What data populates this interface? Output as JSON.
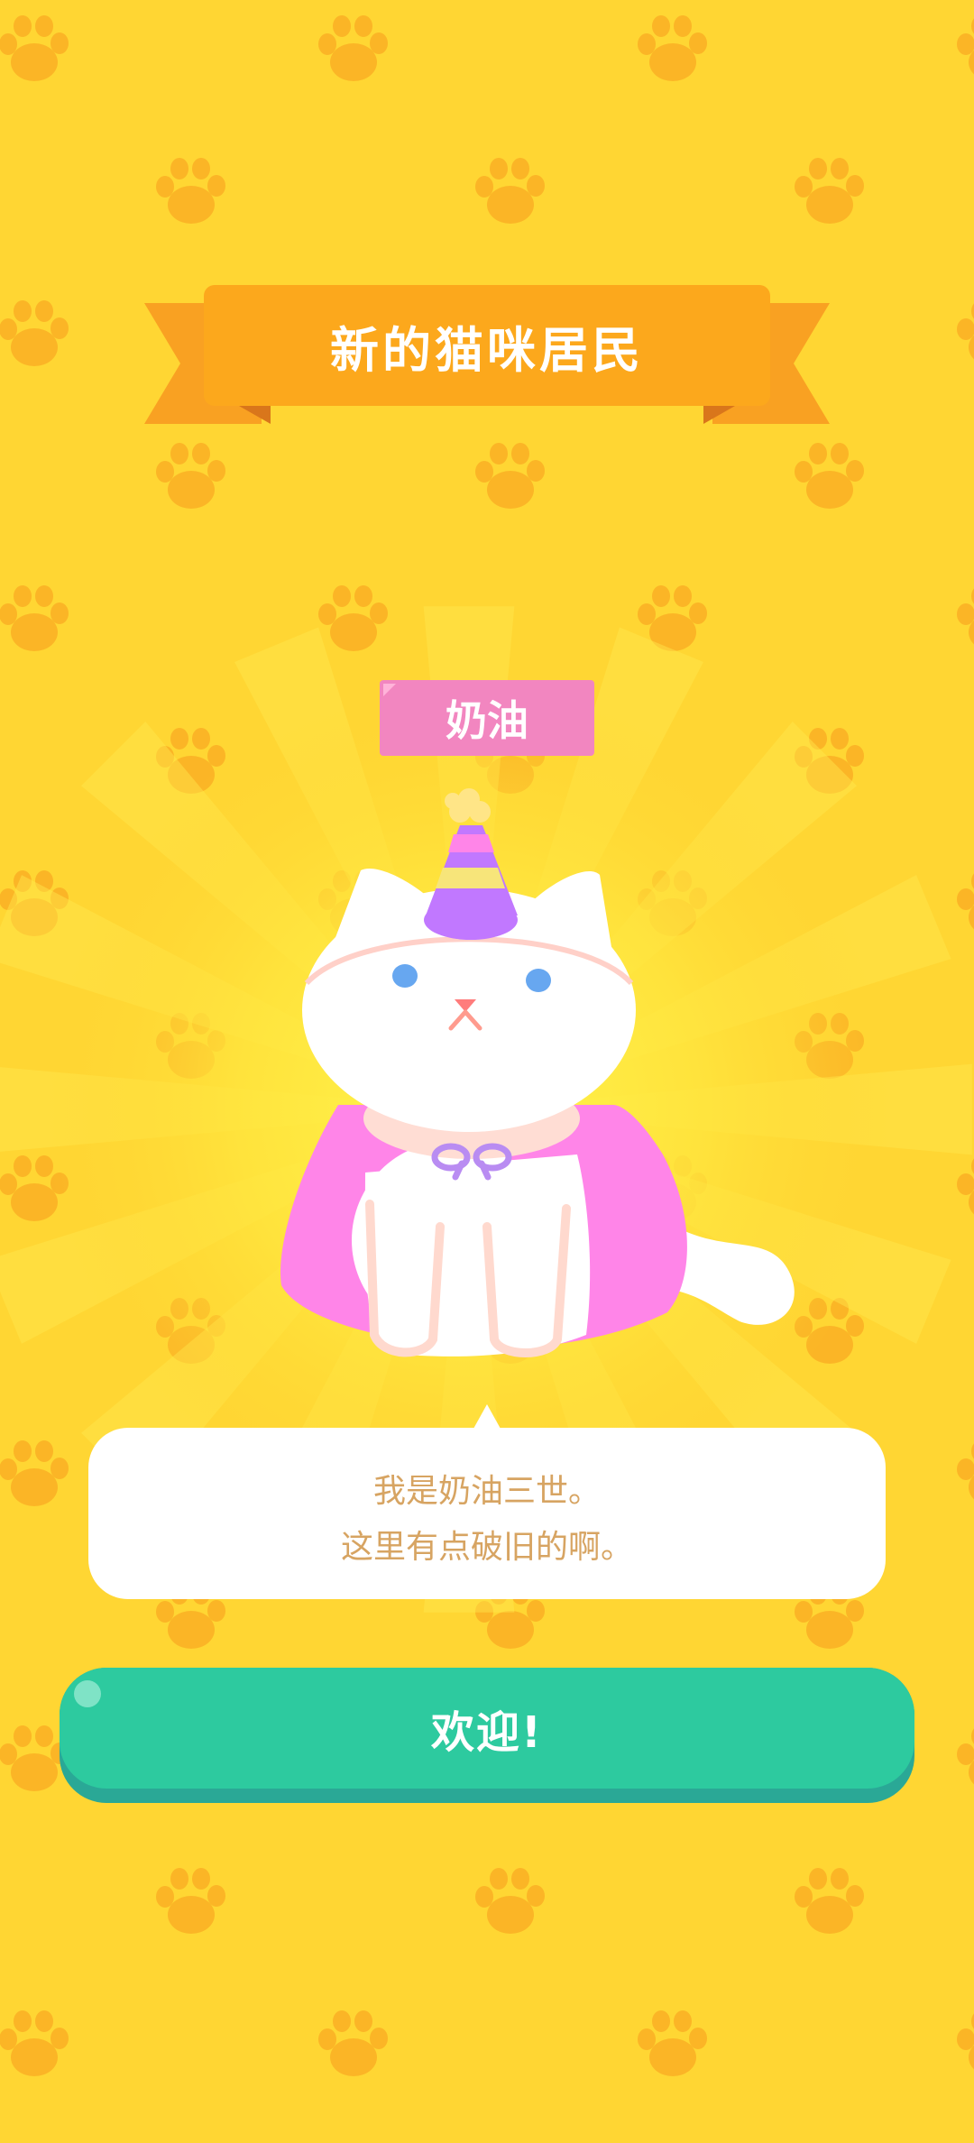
{
  "banner": {
    "title": "新的猫咪居民"
  },
  "cat": {
    "name": "奶油"
  },
  "dialog": {
    "lines": [
      "我是奶油三世。",
      "这里有点破旧的啊。"
    ]
  },
  "actions": {
    "welcome_label": "欢迎!"
  },
  "colors": {
    "background": "#FFD633",
    "paw_print": "#FBB526",
    "ribbon": "#FCA81C",
    "name_tag": "#F286C0",
    "dialog_text": "#D7A462",
    "button": "#2DCA9F",
    "cape": "#FF85E8",
    "party_hat": "#C178FF"
  },
  "icons": [
    "paw-print-icon",
    "party-hat-icon"
  ]
}
